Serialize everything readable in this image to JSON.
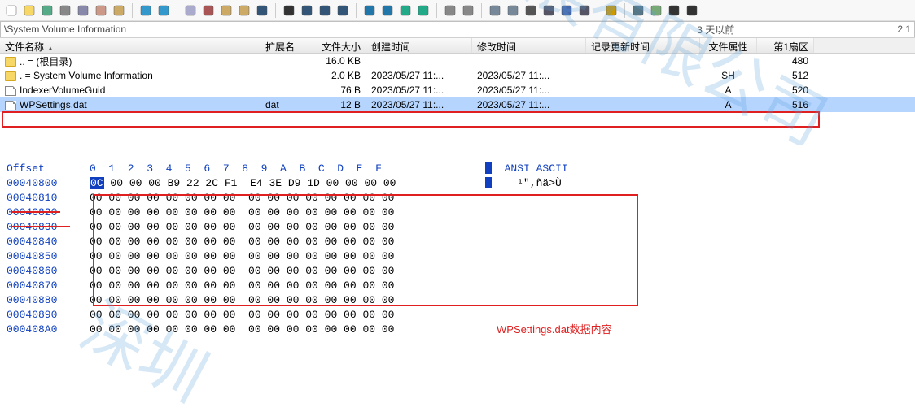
{
  "toolbar_icons": [
    "new-doc",
    "open-folder",
    "save",
    "print",
    "print-preview",
    "clipboard",
    "cabinet",
    "sep",
    "undo",
    "redo",
    "sep",
    "copy",
    "cut",
    "paste",
    "paste-special",
    "binary",
    "sep",
    "find",
    "find-hex",
    "hex-label",
    "replace-hex",
    "sep",
    "goto-start",
    "goto-end",
    "back",
    "forward",
    "sep",
    "nav-a",
    "nav-b",
    "sep",
    "disk",
    "disk2",
    "chip",
    "calc",
    "search",
    "camera",
    "sep",
    "gear",
    "sep",
    "tree",
    "report",
    "prev",
    "next"
  ],
  "pathbar": {
    "path": "\\System Volume Information",
    "timeinfo": "3 天以前",
    "right": "2 1"
  },
  "columns": {
    "name": "文件名称",
    "ext": "扩展名",
    "size": "文件大小",
    "ctime": "创建时间",
    "mtime": "修改时间",
    "rtime": "记录更新时间",
    "attr": "文件属性",
    "sect": "第1扇区"
  },
  "rows": [
    {
      "icon": "folder",
      "name": ".. = (根目录)",
      "ext": "",
      "size": "16.0 KB",
      "ctime": "",
      "mtime": "",
      "rtime": "",
      "attr": "",
      "sect": "480"
    },
    {
      "icon": "folder",
      "name": ". = System Volume Information",
      "ext": "",
      "size": "2.0 KB",
      "ctime": "2023/05/27 11:...",
      "mtime": "2023/05/27 11:...",
      "rtime": "",
      "attr": "SH",
      "sect": "512"
    },
    {
      "icon": "page",
      "name": "IndexerVolumeGuid",
      "ext": "",
      "size": "76 B",
      "ctime": "2023/05/27 11:...",
      "mtime": "2023/05/27 11:...",
      "rtime": "",
      "attr": "A",
      "sect": "520"
    },
    {
      "icon": "page",
      "name": "WPSettings.dat",
      "ext": "dat",
      "size": "12 B",
      "ctime": "2023/05/27 11:...",
      "mtime": "2023/05/27 11:...",
      "rtime": "",
      "attr": "A",
      "sect": "516",
      "selected": true
    }
  ],
  "hex": {
    "offset_label": "Offset",
    "cols_left": "0  1  2  3  4  5  6  7 ",
    "cols_right": " 8  9  A  B  C  D  E  F ",
    "ascii_header": "ANSI ASCII",
    "rows": [
      {
        "off": "00040800",
        "l": "0C 00 00 00 B9 22 2C F1 ",
        "r": " E4 3E D9 1D 00 00 00 00",
        "a": "    ¹\",ñä>Ù"
      },
      {
        "off": "00040810",
        "l": "00 00 00 00 00 00 00 00 ",
        "r": " 00 00 00 00 00 00 00 00",
        "a": ""
      },
      {
        "off": "00040820",
        "l": "00 00 00 00 00 00 00 00 ",
        "r": " 00 00 00 00 00 00 00 00",
        "a": ""
      },
      {
        "off": "00040830",
        "l": "00 00 00 00 00 00 00 00 ",
        "r": " 00 00 00 00 00 00 00 00",
        "a": ""
      },
      {
        "off": "00040840",
        "l": "00 00 00 00 00 00 00 00 ",
        "r": " 00 00 00 00 00 00 00 00",
        "a": ""
      },
      {
        "off": "00040850",
        "l": "00 00 00 00 00 00 00 00 ",
        "r": " 00 00 00 00 00 00 00 00",
        "a": ""
      },
      {
        "off": "00040860",
        "l": "00 00 00 00 00 00 00 00 ",
        "r": " 00 00 00 00 00 00 00 00",
        "a": ""
      },
      {
        "off": "00040870",
        "l": "00 00 00 00 00 00 00 00 ",
        "r": " 00 00 00 00 00 00 00 00",
        "a": ""
      },
      {
        "off": "00040880",
        "l": "00 00 00 00 00 00 00 00 ",
        "r": " 00 00 00 00 00 00 00 00",
        "a": ""
      },
      {
        "off": "00040890",
        "l": "00 00 00 00 00 00 00 00 ",
        "r": " 00 00 00 00 00 00 00 00",
        "a": ""
      },
      {
        "off": "000408A0",
        "l": "00 00 00 00 00 00 00 00 ",
        "r": " 00 00 00 00 00 00 00 00",
        "a": ""
      }
    ]
  },
  "annotation": "WPSettings.dat数据内容",
  "watermark_a": "发展有限公司",
  "watermark_b": "深圳"
}
